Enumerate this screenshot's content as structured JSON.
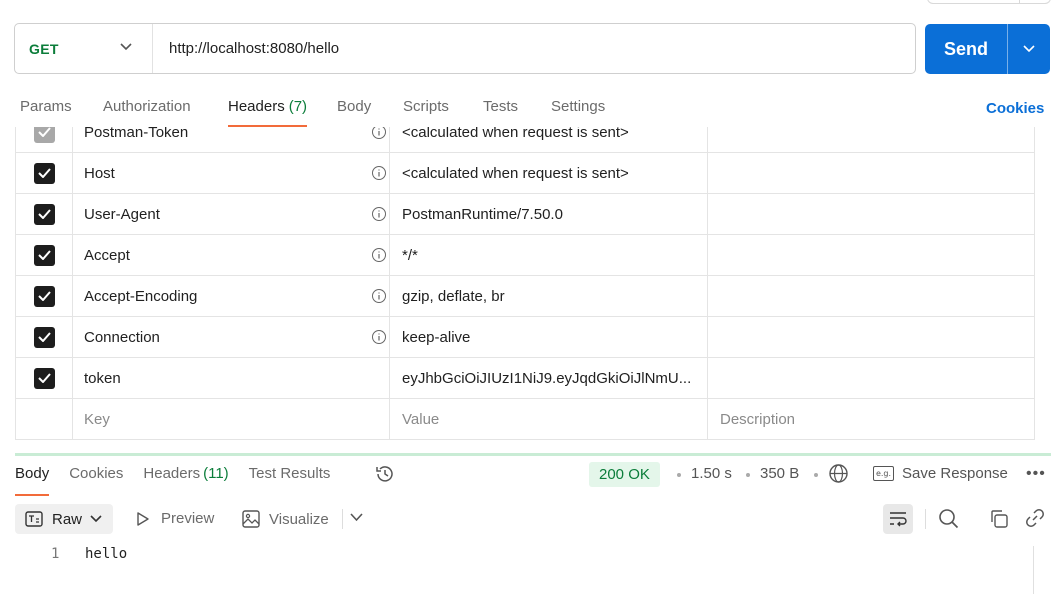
{
  "request": {
    "method": "GET",
    "url": "http://localhost:8080/hello",
    "send_label": "Send"
  },
  "request_tabs": [
    {
      "label": "Params"
    },
    {
      "label": "Authorization"
    },
    {
      "label": "Headers",
      "count": "(7)"
    },
    {
      "label": "Body"
    },
    {
      "label": "Scripts"
    },
    {
      "label": "Tests"
    },
    {
      "label": "Settings"
    }
  ],
  "cookies_link": "Cookies",
  "headers": [
    {
      "key": "Postman-Token",
      "value": "<calculated when request is sent>",
      "checked": true,
      "locked": true
    },
    {
      "key": "Host",
      "value": "<calculated when request is sent>",
      "checked": true
    },
    {
      "key": "User-Agent",
      "value": "PostmanRuntime/7.50.0",
      "checked": true
    },
    {
      "key": "Accept",
      "value": "*/*",
      "checked": true
    },
    {
      "key": "Accept-Encoding",
      "value": "gzip, deflate, br",
      "checked": true
    },
    {
      "key": "Connection",
      "value": "keep-alive",
      "checked": true
    },
    {
      "key": "token",
      "value": "eyJhbGciOiJIUzI1NiJ9.eyJqdGkiOiJlNmU...",
      "checked": true
    }
  ],
  "headers_placeholder": {
    "key": "Key",
    "value": "Value",
    "description": "Description"
  },
  "response_tabs": [
    {
      "label": "Body"
    },
    {
      "label": "Cookies"
    },
    {
      "label": "Headers",
      "count": "(11)"
    },
    {
      "label": "Test Results"
    }
  ],
  "response_meta": {
    "status": "200 OK",
    "time": "1.50 s",
    "size": "350 B",
    "save_label": "Save Response"
  },
  "body_toolbar": {
    "format": "Raw",
    "preview": "Preview",
    "visualize": "Visualize"
  },
  "response_body": [
    {
      "line": "1",
      "text": "hello"
    }
  ],
  "colors": {
    "accent_blue": "#0b6fd7",
    "method_green": "#0b7d3a",
    "tab_underline": "#f26b3a",
    "status_bg": "#e4f6ea"
  }
}
